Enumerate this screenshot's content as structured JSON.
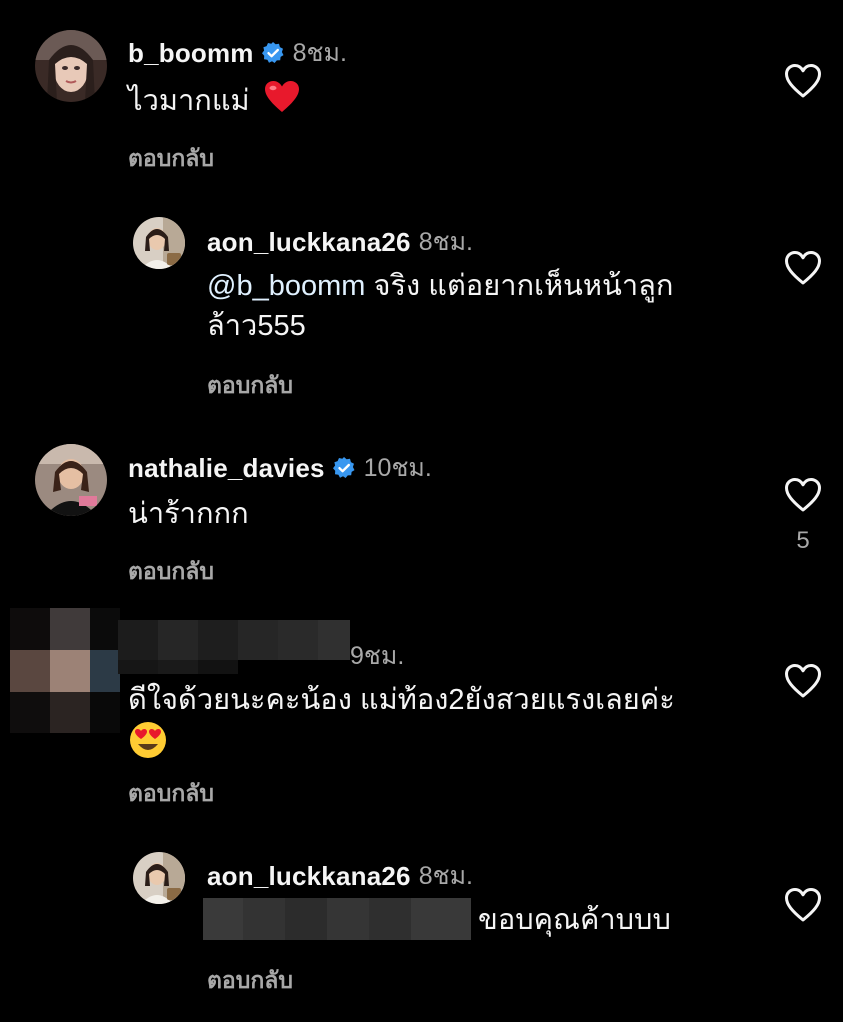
{
  "comments": [
    {
      "username": "b_boomm",
      "verified": true,
      "time": "8ชม.",
      "text": "ไวมากแม่",
      "emoji": "heart-emoji",
      "reply_label": "ตอบกลับ",
      "likes": ""
    },
    {
      "username": "aon_luckkana26",
      "verified": false,
      "time": "8ชม.",
      "mention": "@b_boomm",
      "text_line1": "จริง แต่อยากเห็นหน้าลูก",
      "text_line2": "ล้าว555",
      "reply_label": "ตอบกลับ",
      "likes": ""
    },
    {
      "username": "nathalie_davies",
      "verified": true,
      "time": "10ชม.",
      "text": "น่าร้ากกก",
      "reply_label": "ตอบกลับ",
      "likes": "5"
    },
    {
      "username": "",
      "verified": false,
      "time": "9ชม.",
      "text_line1": "ดีใจด้วยนะคะน้อง แม่ท้อง2ยังสวยแรงเลยค่ะ",
      "emoji": "heart-eyes-emoji",
      "reply_label": "ตอบกลับ",
      "likes": ""
    },
    {
      "username": "aon_luckkana26",
      "verified": false,
      "time": "8ชม.",
      "text": "ขอบคุณค้าบบบ",
      "reply_label": "ตอบกลับ",
      "likes": ""
    }
  ],
  "colors": {
    "background": "#000000",
    "text": "#f5f5f5",
    "secondary": "#a8a8a8",
    "verified": "#3897f0",
    "mention": "#e0f1ff"
  },
  "icons": [
    "verified-badge-icon",
    "heart-outline-icon",
    "heart-emoji",
    "heart-eyes-emoji"
  ]
}
